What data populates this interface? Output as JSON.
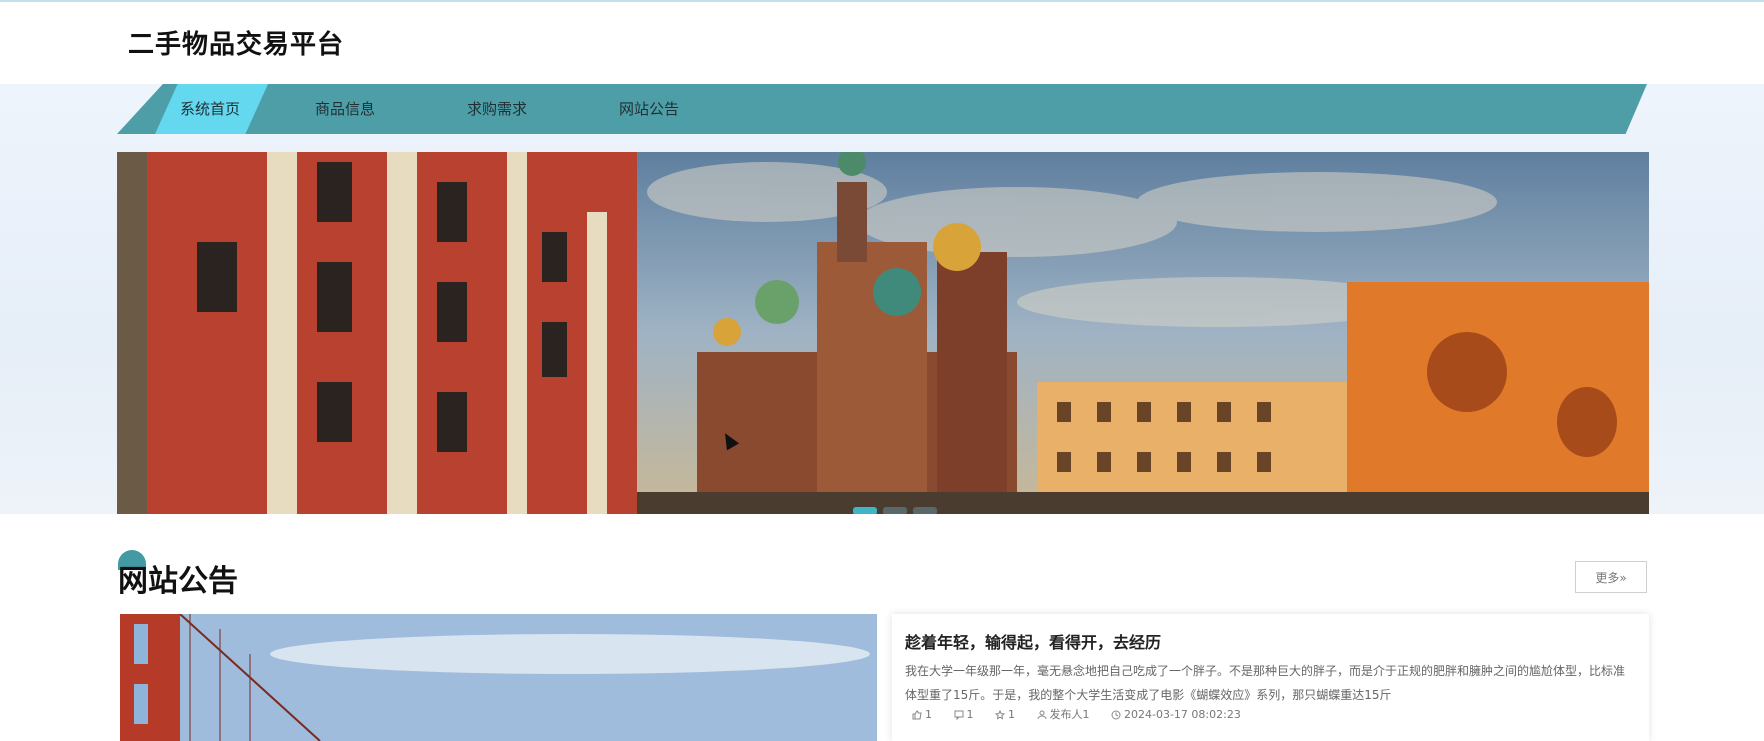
{
  "header": {
    "title": "二手物品交易平台"
  },
  "nav": {
    "items": [
      {
        "label": "系统首页",
        "active": true
      },
      {
        "label": "商品信息",
        "active": false
      },
      {
        "label": "求购需求",
        "active": false
      },
      {
        "label": "网站公告",
        "active": false
      }
    ],
    "color": "#4e9ea8",
    "active_color": "#63d8ef"
  },
  "carousel": {
    "slide_count": 3,
    "active_index": 0
  },
  "notices": {
    "section_title": "网站公告",
    "more_label": "更多»",
    "featured": {
      "title": "趁着年轻，输得起，看得开，去经历",
      "body": "我在大学一年级那一年，毫无悬念地把自己吃成了一个胖子。不是那种巨大的胖子，而是介于正规的肥胖和臃肿之间的尴尬体型，比标准体型重了15斤。于是，我的整个大学生活变成了电影《蝴蝶效应》系列，那只蝴蝶重达15斤",
      "likes": "1",
      "comments": "1",
      "favorites": "1",
      "publisher": "发布人1",
      "date": "2024-03-17 08:02:23"
    }
  }
}
